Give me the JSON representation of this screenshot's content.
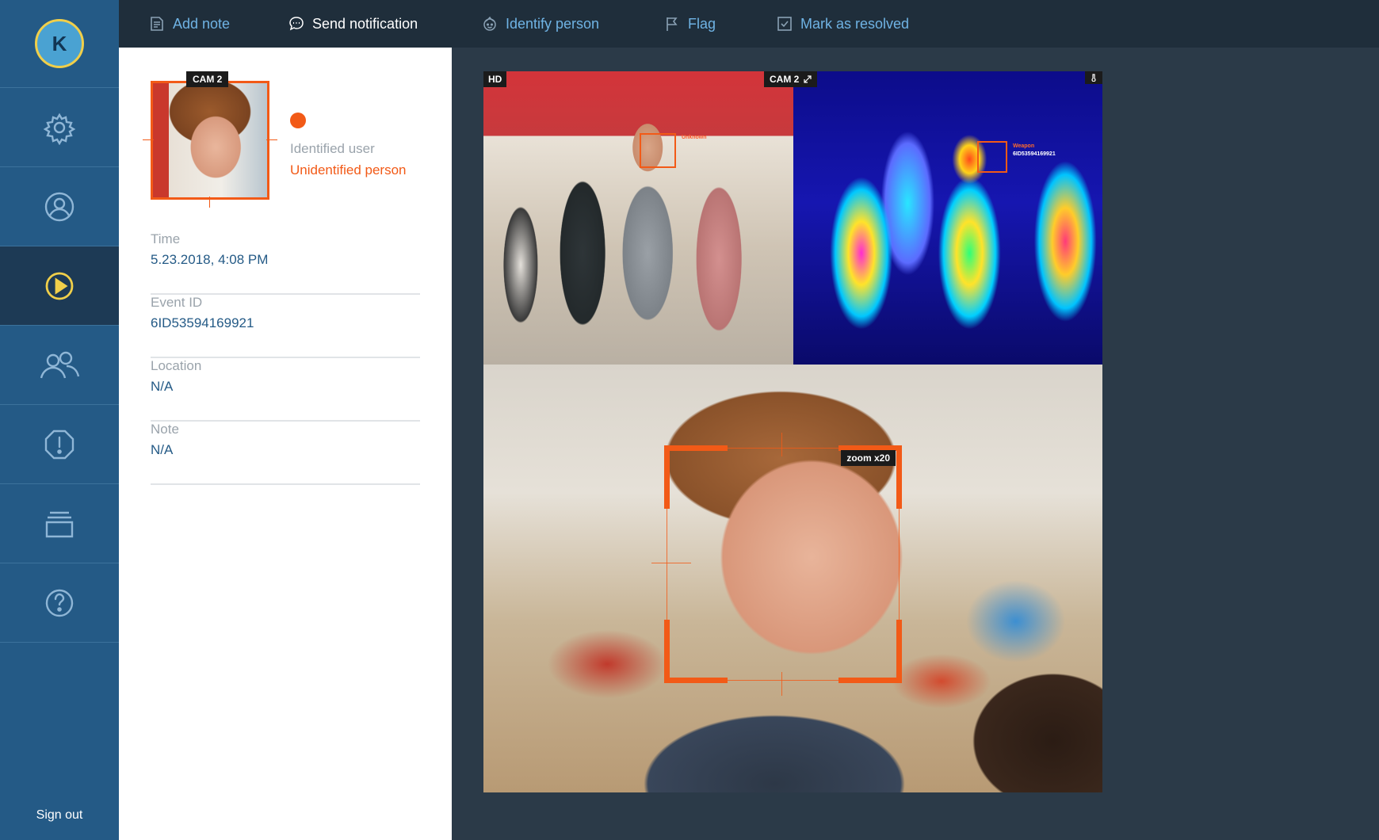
{
  "user": {
    "initial": "K"
  },
  "sidebar": {
    "items": [
      {
        "id": "settings",
        "icon": "gear-icon"
      },
      {
        "id": "profile",
        "icon": "user-icon"
      },
      {
        "id": "events",
        "icon": "play-icon",
        "active": true
      },
      {
        "id": "people",
        "icon": "users-icon"
      },
      {
        "id": "alerts",
        "icon": "alert-icon"
      },
      {
        "id": "archive",
        "icon": "archive-icon"
      },
      {
        "id": "help",
        "icon": "help-icon"
      }
    ],
    "sign_out": "Sign out"
  },
  "toolbar": {
    "add_note": "Add note",
    "send_notification": "Send notification",
    "identify_person": "Identify person",
    "flag": "Flag",
    "mark_resolved": "Mark as resolved"
  },
  "details": {
    "camera_tag": "CAM 2",
    "identified_label": "Identified user",
    "identified_value": "Unidentified person",
    "fields": [
      {
        "label": "Time",
        "value": "5.23.2018, 4:08 PM"
      },
      {
        "label": "Event ID",
        "value": "6ID53594169921"
      },
      {
        "label": "Location",
        "value": "N/A"
      },
      {
        "label": "Note",
        "value": "N/A"
      }
    ]
  },
  "video": {
    "hd_tag": "HD",
    "cam_tag": "CAM 2",
    "zoom_tag": "zoom x20",
    "face_label": "Unknown",
    "thermal_label": "Weapon",
    "thermal_id": "6ID53594169921"
  },
  "colors": {
    "accent": "#f25a17",
    "link": "#6fb3e4",
    "sidebar": "#245a86",
    "avatar_ring": "#f0cf4a"
  }
}
